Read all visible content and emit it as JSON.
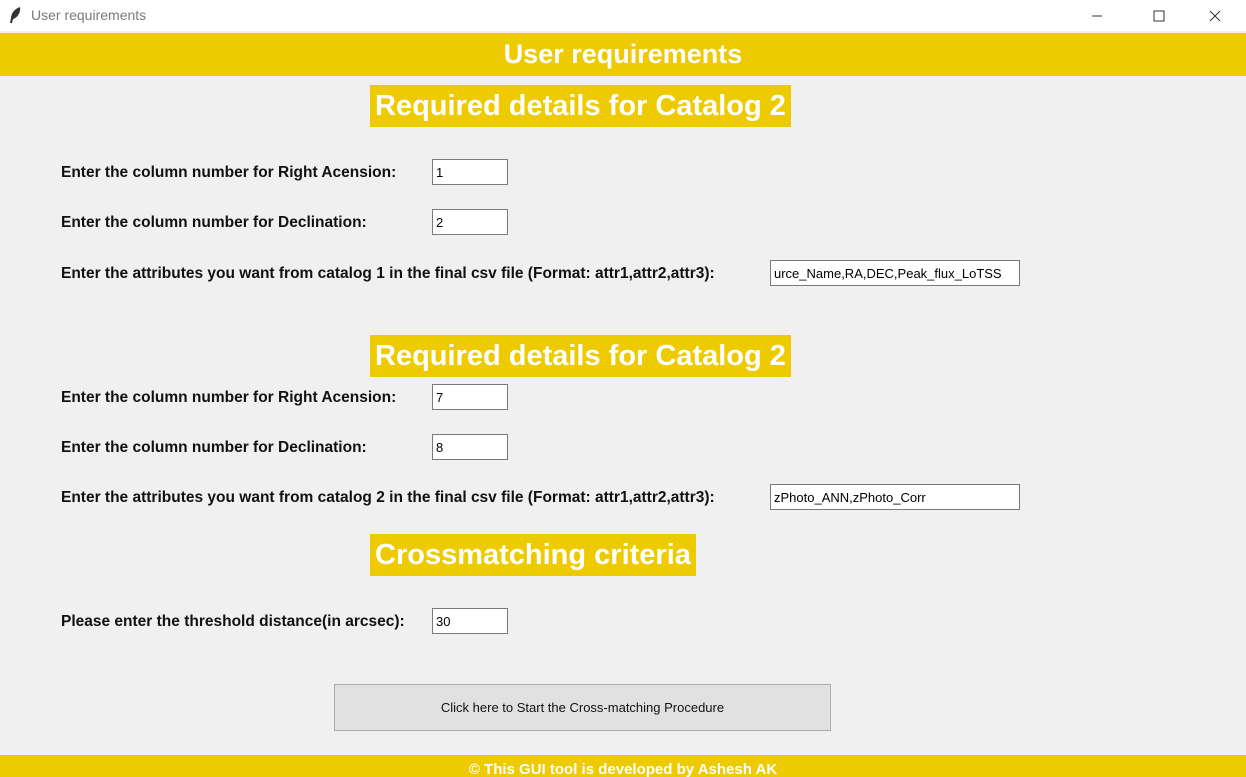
{
  "window": {
    "title": "User requirements",
    "app_icon": "feather-icon",
    "controls": [
      "minimize-icon",
      "maximize-icon",
      "close-icon"
    ]
  },
  "header": {
    "title": "User requirements"
  },
  "catalog1": {
    "section_title": "Required details for Catalog 2",
    "ra_label": "Enter the column number for Right Acension:",
    "ra_value": "1",
    "dec_label": "Enter the column number for Declination:",
    "dec_value": "2",
    "attrs_label": "Enter the attributes you want from catalog 1 in the final csv file (Format: attr1,attr2,attr3):",
    "attrs_value": "urce_Name,RA,DEC,Peak_flux_LoTSS"
  },
  "catalog2": {
    "section_title": "Required details for Catalog 2",
    "ra_label": "Enter the column number for Right Acension:",
    "ra_value": "7",
    "dec_label": "Enter the column number for Declination:",
    "dec_value": "8",
    "attrs_label": "Enter the attributes you want from catalog 2 in the final csv file (Format: attr1,attr2,attr3):",
    "attrs_value": "zPhoto_ANN,zPhoto_Corr"
  },
  "criteria": {
    "section_title": "Crossmatching criteria",
    "threshold_label": "Please enter the threshold distance(in arcsec):",
    "threshold_value": "30"
  },
  "actions": {
    "start_label": "Click here to Start the Cross-matching Procedure"
  },
  "footer": {
    "text": "© This GUI tool is developed by Ashesh AK"
  },
  "colors": {
    "accent": "#eecb00",
    "background": "#f0f0f0",
    "text_on_accent": "#ffffff"
  }
}
